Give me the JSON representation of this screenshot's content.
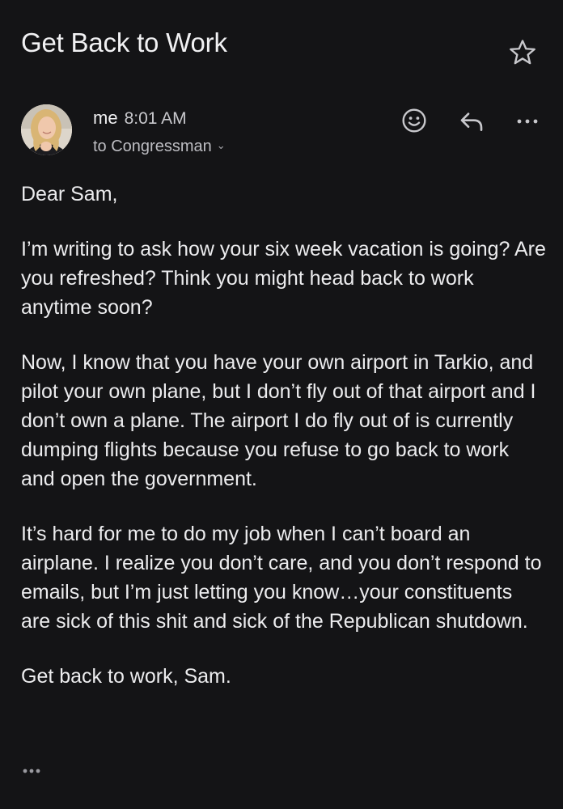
{
  "email": {
    "subject": "Get Back to Work",
    "sender": {
      "name": "me",
      "time": "8:01 AM",
      "recipient_text": "to Congressman"
    },
    "icons": {
      "star": "star-icon",
      "react": "smiley-icon",
      "reply": "reply-icon",
      "more": "more-horizontal-icon",
      "expand_quoted": "ellipsis-icon"
    },
    "body": {
      "greeting": "Dear Sam,",
      "paragraph_1": "I’m writing to ask how your six week vacation is going? Are you refreshed? Think you might head back to work anytime soon?",
      "paragraph_2": "Now, I know that you have your own airport in Tarkio, and pilot your own plane, but I don’t fly out of that airport and I don’t own a plane. The airport I do fly out of is currently dumping flights because you refuse to go back to work and open the government.",
      "paragraph_3": "It’s hard for me to do my job when I can’t board an airplane. I realize you don’t care, and you don’t respond to emails, but I’m just letting you know…your constituents are sick of this shit and sick of the Republican shutdown.",
      "closing": "Get back to work, Sam."
    }
  },
  "colors": {
    "background": "#141416",
    "text_primary": "#ececee",
    "text_secondary": "#bdbdc2",
    "icon": "#c8c8cc"
  }
}
